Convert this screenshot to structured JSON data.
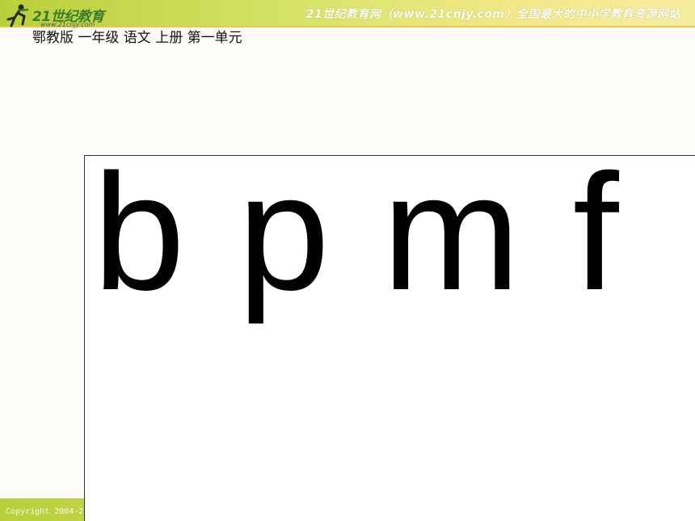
{
  "header": {
    "logo_brand": "21世纪教育",
    "logo_url": "www.21cnjy.com",
    "site_title": "21世纪教育网（www.21cnjy.com）全国最大的中小学教育资源网站",
    "breadcrumb": "鄂教版  一年级  语文 上册 第一单元"
  },
  "slide": {
    "letters": [
      "b",
      "p",
      "m",
      "f"
    ]
  },
  "footer": {
    "copyright": "Copyright 2004-2"
  },
  "colors": {
    "header_green": "#b9cf3a",
    "header_yellow": "#f7eda0",
    "brand_green": "#3b7d2e"
  }
}
